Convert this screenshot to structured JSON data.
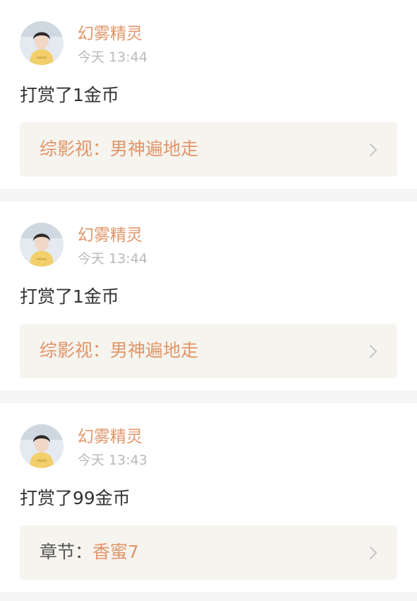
{
  "feed": {
    "items": [
      {
        "username": "幻雾精灵",
        "time": "今天 13:44",
        "action": "打赏了1金币",
        "link_prefix": "综影视：",
        "link_title": "男神遍地走"
      },
      {
        "username": "幻雾精灵",
        "time": "今天 13:44",
        "action": "打赏了1金币",
        "link_prefix": "综影视：",
        "link_title": "男神遍地走"
      },
      {
        "username": "幻雾精灵",
        "time": "今天 13:43",
        "action": "打赏了99金币",
        "link_prefix": "章节：",
        "link_title": "香蜜7"
      }
    ]
  },
  "colors": {
    "accent": "#e0956a",
    "timestamp": "#b9b9b9",
    "body_text": "#333333",
    "link_bg": "#f6f4ee",
    "divider_bg": "#f5f5f5"
  },
  "icons": {
    "avatar": "user-avatar-photo",
    "chevron": "chevron-right-icon"
  }
}
